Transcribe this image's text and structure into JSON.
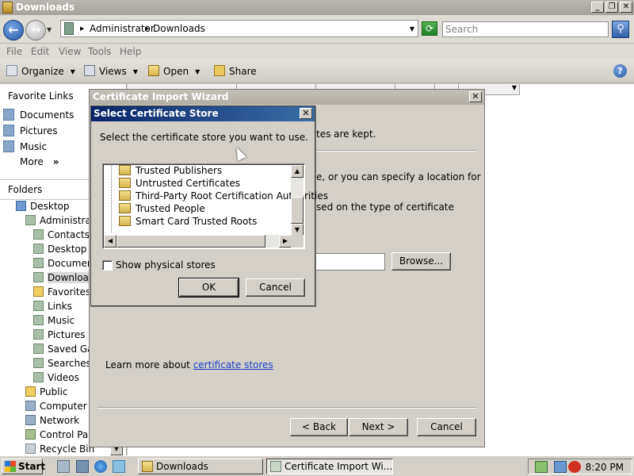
{
  "explorer": {
    "title": "Downloads",
    "window_buttons": [
      "_",
      "❐",
      "✕"
    ],
    "breadcrumb": [
      "Administrator",
      "Downloads"
    ],
    "search_placeholder": "Search",
    "menu": [
      "File",
      "Edit",
      "View",
      "Tools",
      "Help"
    ],
    "toolbar": {
      "organize": "Organize",
      "views": "Views",
      "open": "Open",
      "share": "Share"
    },
    "favorite_links_title": "Favorite Links",
    "favorites": [
      "Documents",
      "Pictures",
      "Music",
      "More"
    ],
    "folders_title": "Folders",
    "tree": [
      "Desktop",
      "Administrator",
      "Contacts",
      "Desktop",
      "Documents",
      "Downloads",
      "Favorites",
      "Links",
      "Music",
      "Pictures",
      "Saved Games",
      "Searches",
      "Videos",
      "Public",
      "Computer",
      "Network",
      "Control Panel",
      "Recycle Bin"
    ]
  },
  "wizard": {
    "title": "Certificate Import Wizard",
    "partial_line1": "tes are kept.",
    "partial_line2": "e, or you can specify a location for",
    "partial_line3": "sed on the type of certificate",
    "browse_label": "Browse...",
    "learn_more_prefix": "Learn more about ",
    "learn_more_link": "certificate stores",
    "back_label": "< Back",
    "next_label": "Next >",
    "cancel_label": "Cancel"
  },
  "store_dialog": {
    "title": "Select Certificate Store",
    "instruction": "Select the certificate store you want to use.",
    "stores": [
      "Trusted Publishers",
      "Untrusted Certificates",
      "Third-Party Root Certification Authorities",
      "Trusted People",
      "Smart Card Trusted Roots"
    ],
    "show_physical_label": "Show physical stores",
    "show_physical_checked": false,
    "ok_label": "OK",
    "cancel_label": "Cancel"
  },
  "taskbar": {
    "start_label": "Start",
    "tasks": [
      "Downloads",
      "Certificate Import Wi..."
    ],
    "clock": "8:20 PM"
  },
  "colors": {
    "dialog_title_active": "#0a246a",
    "link": "#1a40c8",
    "face": "#d4d0c8"
  }
}
